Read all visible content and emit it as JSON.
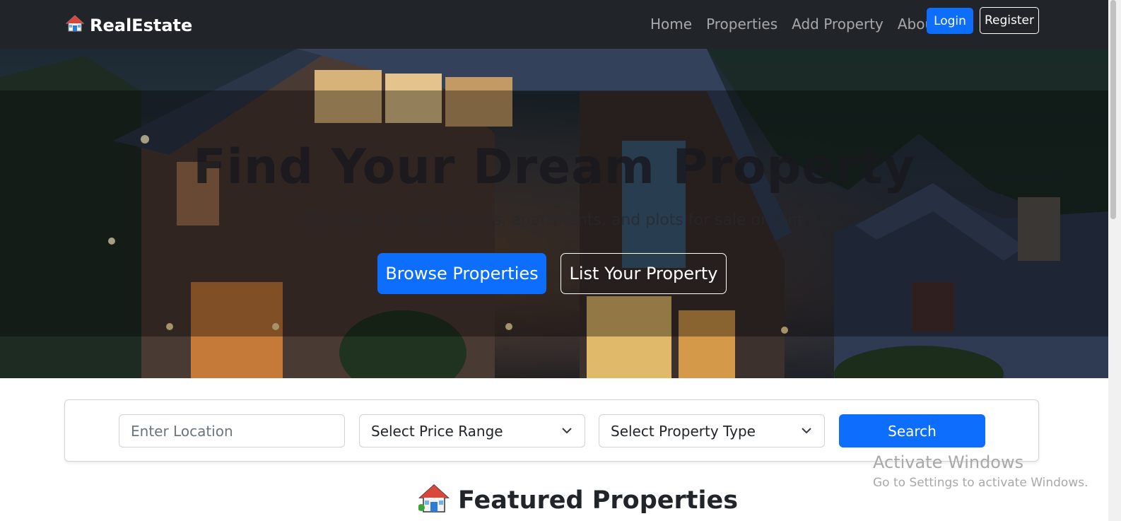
{
  "navbar": {
    "brand": "RealEstate",
    "brand_icon": "house-icon",
    "links": [
      "Home",
      "Properties",
      "Add Property",
      "About"
    ],
    "login_label": "Login",
    "register_label": "Register"
  },
  "hero": {
    "title": "Find Your Dream Property",
    "subtitle": "Discover the best houses, apartments, and plots for sale or rent",
    "browse_label": "Browse Properties",
    "list_label": "List Your Property"
  },
  "search": {
    "location_placeholder": "Enter Location",
    "price_selected": "Select Price Range",
    "type_selected": "Select Property Type",
    "search_label": "Search"
  },
  "featured": {
    "title": "Featured Properties",
    "icon": "house-icon"
  },
  "os_watermark": {
    "line1": "Activate Windows",
    "line2": "Go to Settings to activate Windows."
  },
  "colors": {
    "navbar_bg": "#212529",
    "primary": "#0d6efd"
  }
}
